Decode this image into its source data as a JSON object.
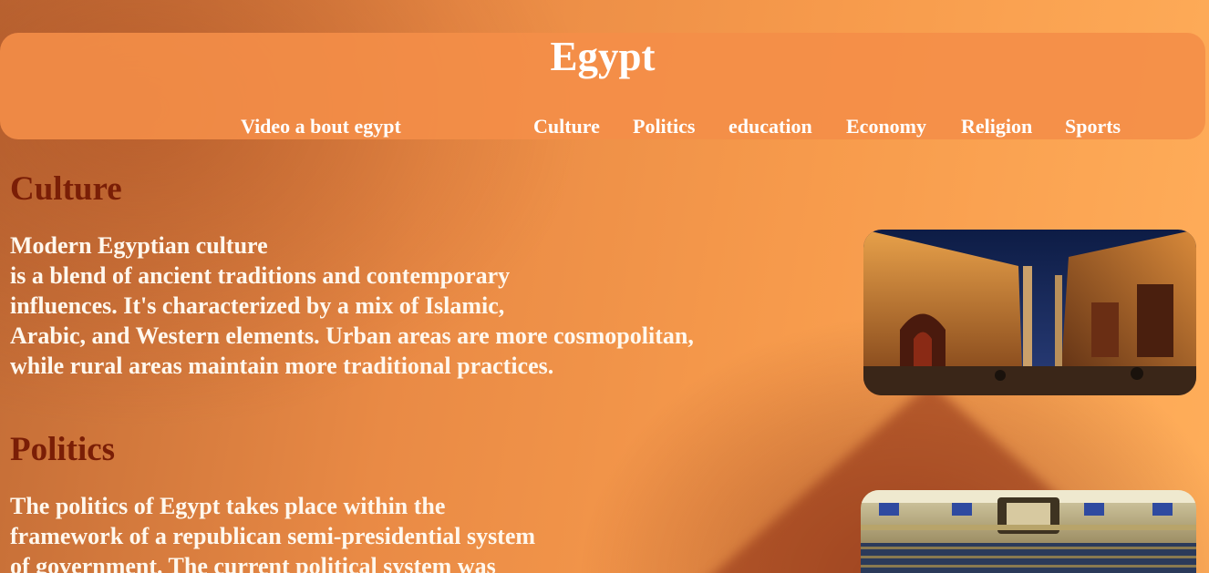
{
  "header": {
    "title": "Egypt",
    "nav": [
      {
        "id": "video",
        "label": "Video a bout egypt"
      },
      {
        "id": "culture",
        "label": "Culture"
      },
      {
        "id": "politics",
        "label": "Politics"
      },
      {
        "id": "education",
        "label": "education"
      },
      {
        "id": "economy",
        "label": "Economy"
      },
      {
        "id": "religion",
        "label": "Religion"
      },
      {
        "id": "sports",
        "label": "Sports"
      }
    ]
  },
  "sections": [
    {
      "title": "Culture",
      "lines": [
        "Modern Egyptian culture",
        "is a blend of ancient traditions and contemporary",
        "influences. It's characterized by a mix of Islamic,",
        "Arabic, and Western elements. Urban areas are more cosmopolitan,",
        "while rural areas maintain more traditional practices."
      ]
    },
    {
      "title": "Politics",
      "lines": [
        "The politics of Egypt takes place within the",
        "framework of a republican semi-presidential system",
        "of government. The current political system was"
      ]
    }
  ]
}
